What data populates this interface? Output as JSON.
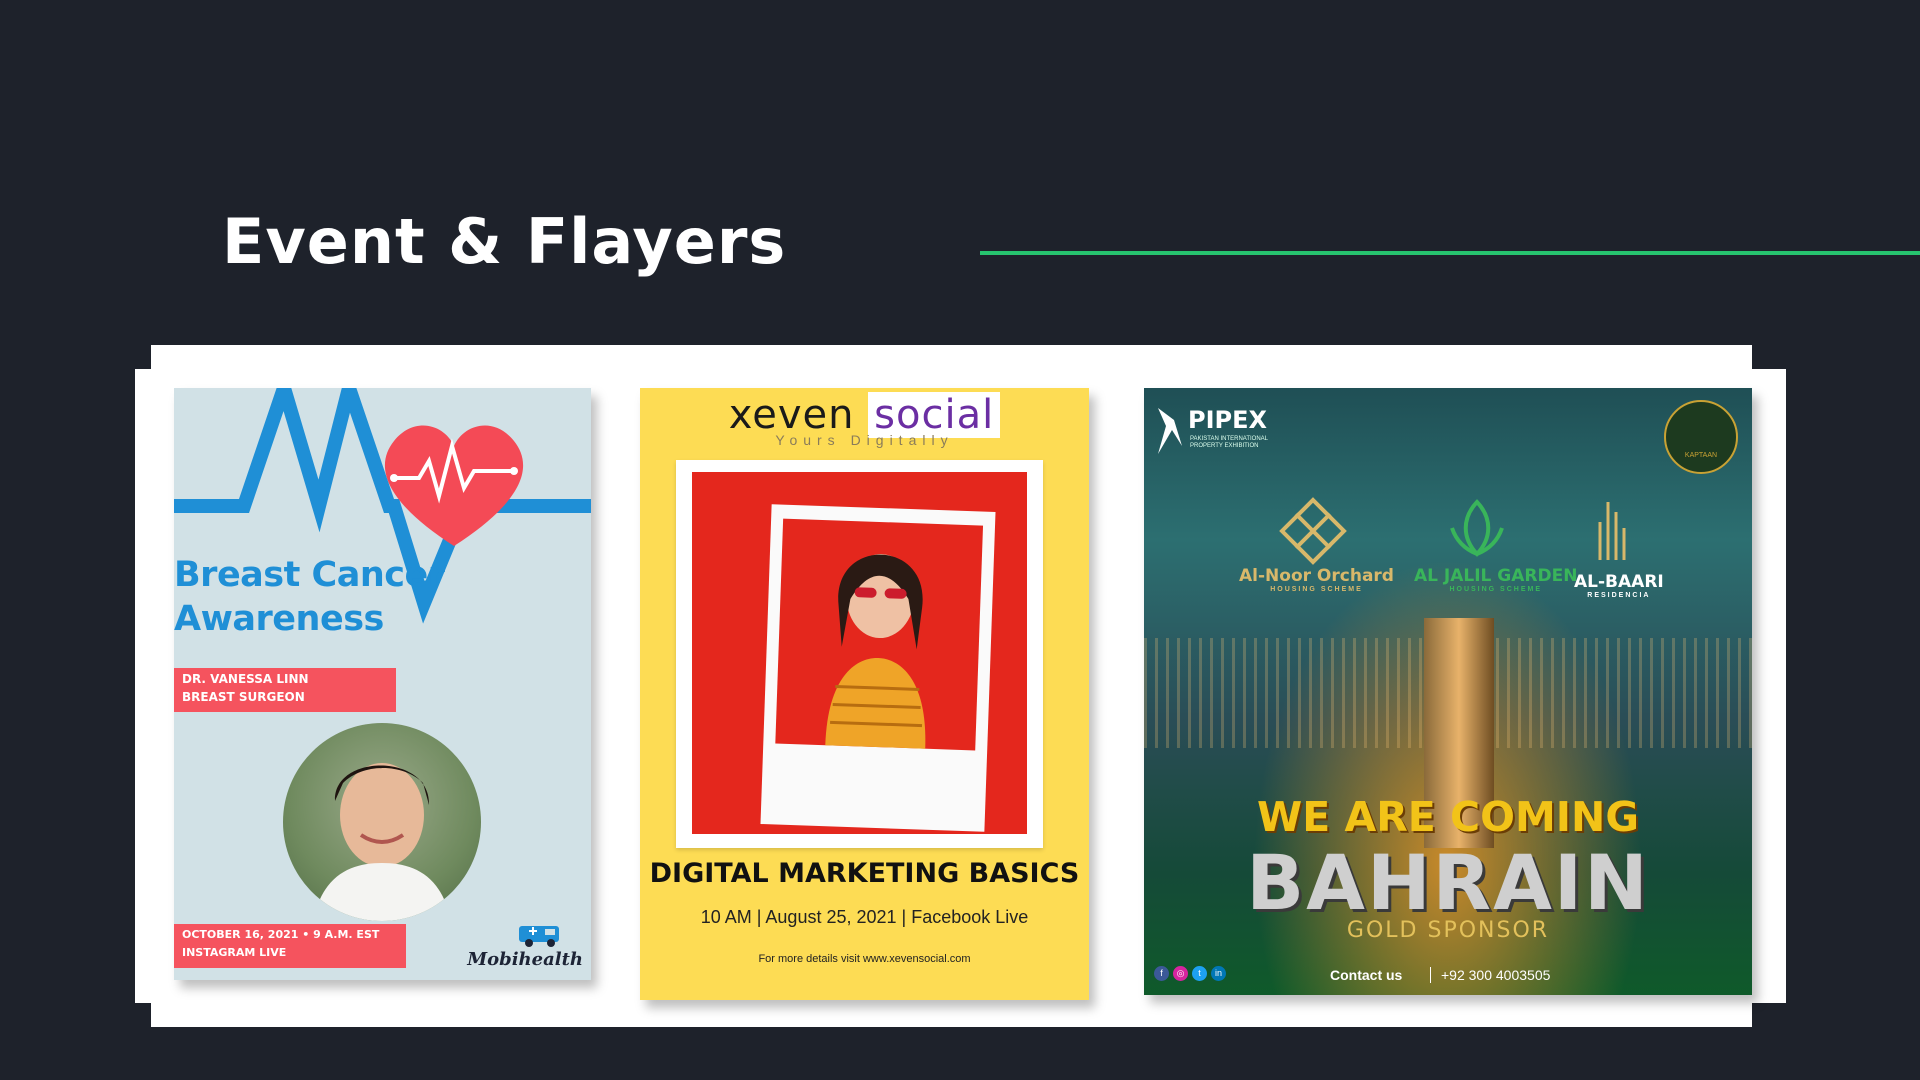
{
  "slide": {
    "title": "Event &  Flayers",
    "accent_color": "#27c46f",
    "background": "#1e222b"
  },
  "flyers": [
    {
      "headline_line1": "Breast Cancer",
      "headline_line2": "Awareness",
      "speaker_name": "DR. VANESSA LINN",
      "speaker_role": "BREAST SURGEON",
      "date_line": "OCTOBER 16, 2021  •  9 A.M. EST",
      "platform": "INSTAGRAM LIVE",
      "brand": "Mobihealth",
      "icons": [
        "heartbeat-heart-icon",
        "ambulance-icon"
      ]
    },
    {
      "brand_part1": "xeven",
      "brand_part2": "social",
      "tagline": "Yours Digitally",
      "heading": "DIGITAL MARKETING BASICS",
      "subline": "10 AM | August 25, 2021 | Facebook Live",
      "details": "For more details visit www.xevensocial.com"
    },
    {
      "organizer": "PIPEX",
      "organizer_sub": "PAKISTAN INTERNATIONAL PROPERTY EXHIBITION",
      "badge": "KAPTAAN",
      "logos": [
        {
          "name": "Al-Noor Orchard",
          "sub": "HOUSING SCHEME"
        },
        {
          "name": "AL JALIL GARDEN",
          "sub": "HOUSING SCHEME"
        },
        {
          "name": "AL-BAARI",
          "sub": "RESIDENCIA"
        }
      ],
      "headline": "WE ARE COMING",
      "location": "BAHRAIN",
      "sponsor": "GOLD SPONSOR",
      "contact_label": "Contact us",
      "phone": "+92 300 4003505",
      "social_icons": [
        "facebook-icon",
        "instagram-icon",
        "twitter-icon",
        "linkedin-icon"
      ]
    }
  ]
}
